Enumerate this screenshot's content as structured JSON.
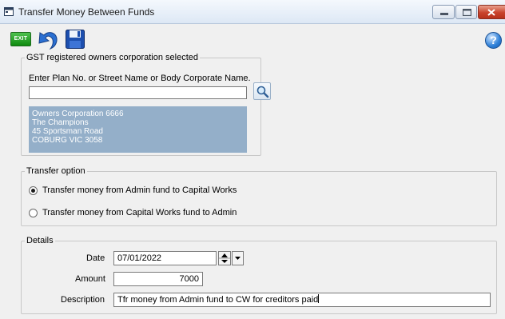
{
  "window": {
    "title": "Transfer Money Between Funds",
    "icons": [
      "app-icon",
      "minimize-icon",
      "maximize-icon",
      "close-icon"
    ]
  },
  "toolbar": {
    "exit_label": "EXIT",
    "buttons": [
      "exit-icon",
      "undo-icon",
      "save-icon",
      "help-icon"
    ],
    "help_label": "?"
  },
  "gst_group": {
    "legend": "GST registered owners corporation selected",
    "prompt": "Enter Plan No. or Street Name or Body Corporate Name.",
    "search_value": "",
    "search_icon": "magnifier-icon",
    "selected_corp": {
      "line1": "Owners Corporation 6666",
      "line2": "The Champions",
      "line3": "45 Sportsman Road",
      "line4": "COBURG  VIC  3058"
    }
  },
  "transfer_group": {
    "legend": "Transfer option",
    "options": [
      {
        "label": "Transfer money from Admin fund to Capital Works",
        "selected": true
      },
      {
        "label": "Transfer money from Capital Works fund to Admin",
        "selected": false
      }
    ]
  },
  "details_group": {
    "legend": "Details",
    "date_label": "Date",
    "date_value": "07/01/2022",
    "amount_label": "Amount",
    "amount_value": "7000",
    "description_label": "Description",
    "description_value": "Tfr money from Admin fund to CW for creditors paid"
  },
  "colors": {
    "selection_panel": "#94afc9",
    "exit_green": "#0f8a0f",
    "close_red": "#c9432c"
  }
}
